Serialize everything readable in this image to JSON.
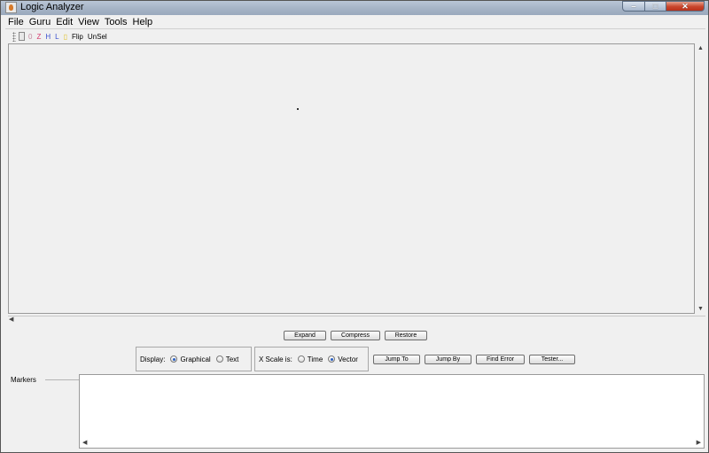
{
  "window": {
    "title": "Logic Analyzer"
  },
  "menu": [
    "File",
    "Guru",
    "Edit",
    "View",
    "Tools",
    "Help"
  ],
  "toolbar": {
    "tools": [
      "0",
      "Z",
      "H",
      "L",
      "",
      "Flip",
      "UnSel"
    ]
  },
  "buttons": {
    "expand": "Expand",
    "compress": "Compress",
    "restore": "Restore",
    "jump_to": "Jump To",
    "jump_by": "Jump By",
    "find_error": "Find Error",
    "tester": "Tester..."
  },
  "display": {
    "label": "Display:",
    "options": [
      "Graphical",
      "Text"
    ],
    "selected": "Graphical"
  },
  "xscale": {
    "label": "X Scale is:",
    "options": [
      "Time",
      "Vector"
    ],
    "selected": "Vector"
  },
  "markers": {
    "label": "Markers"
  },
  "colors": {
    "tool_0": "#c48aa0",
    "tool_z": "#d63a6e",
    "tool_h": "#3a4fcf",
    "tool_l": "#3a4fcf",
    "tool_x": "#e0c12a",
    "radio_selected": "#2a60c4"
  },
  "icons": [
    "app-icon",
    "minimize-icon",
    "maximize-icon",
    "close-icon",
    "toolbar-grip-icon",
    "toolbar-select-icon",
    "scroll-up-icon",
    "scroll-down-icon",
    "scroll-left-icon",
    "scroll-right-icon"
  ]
}
